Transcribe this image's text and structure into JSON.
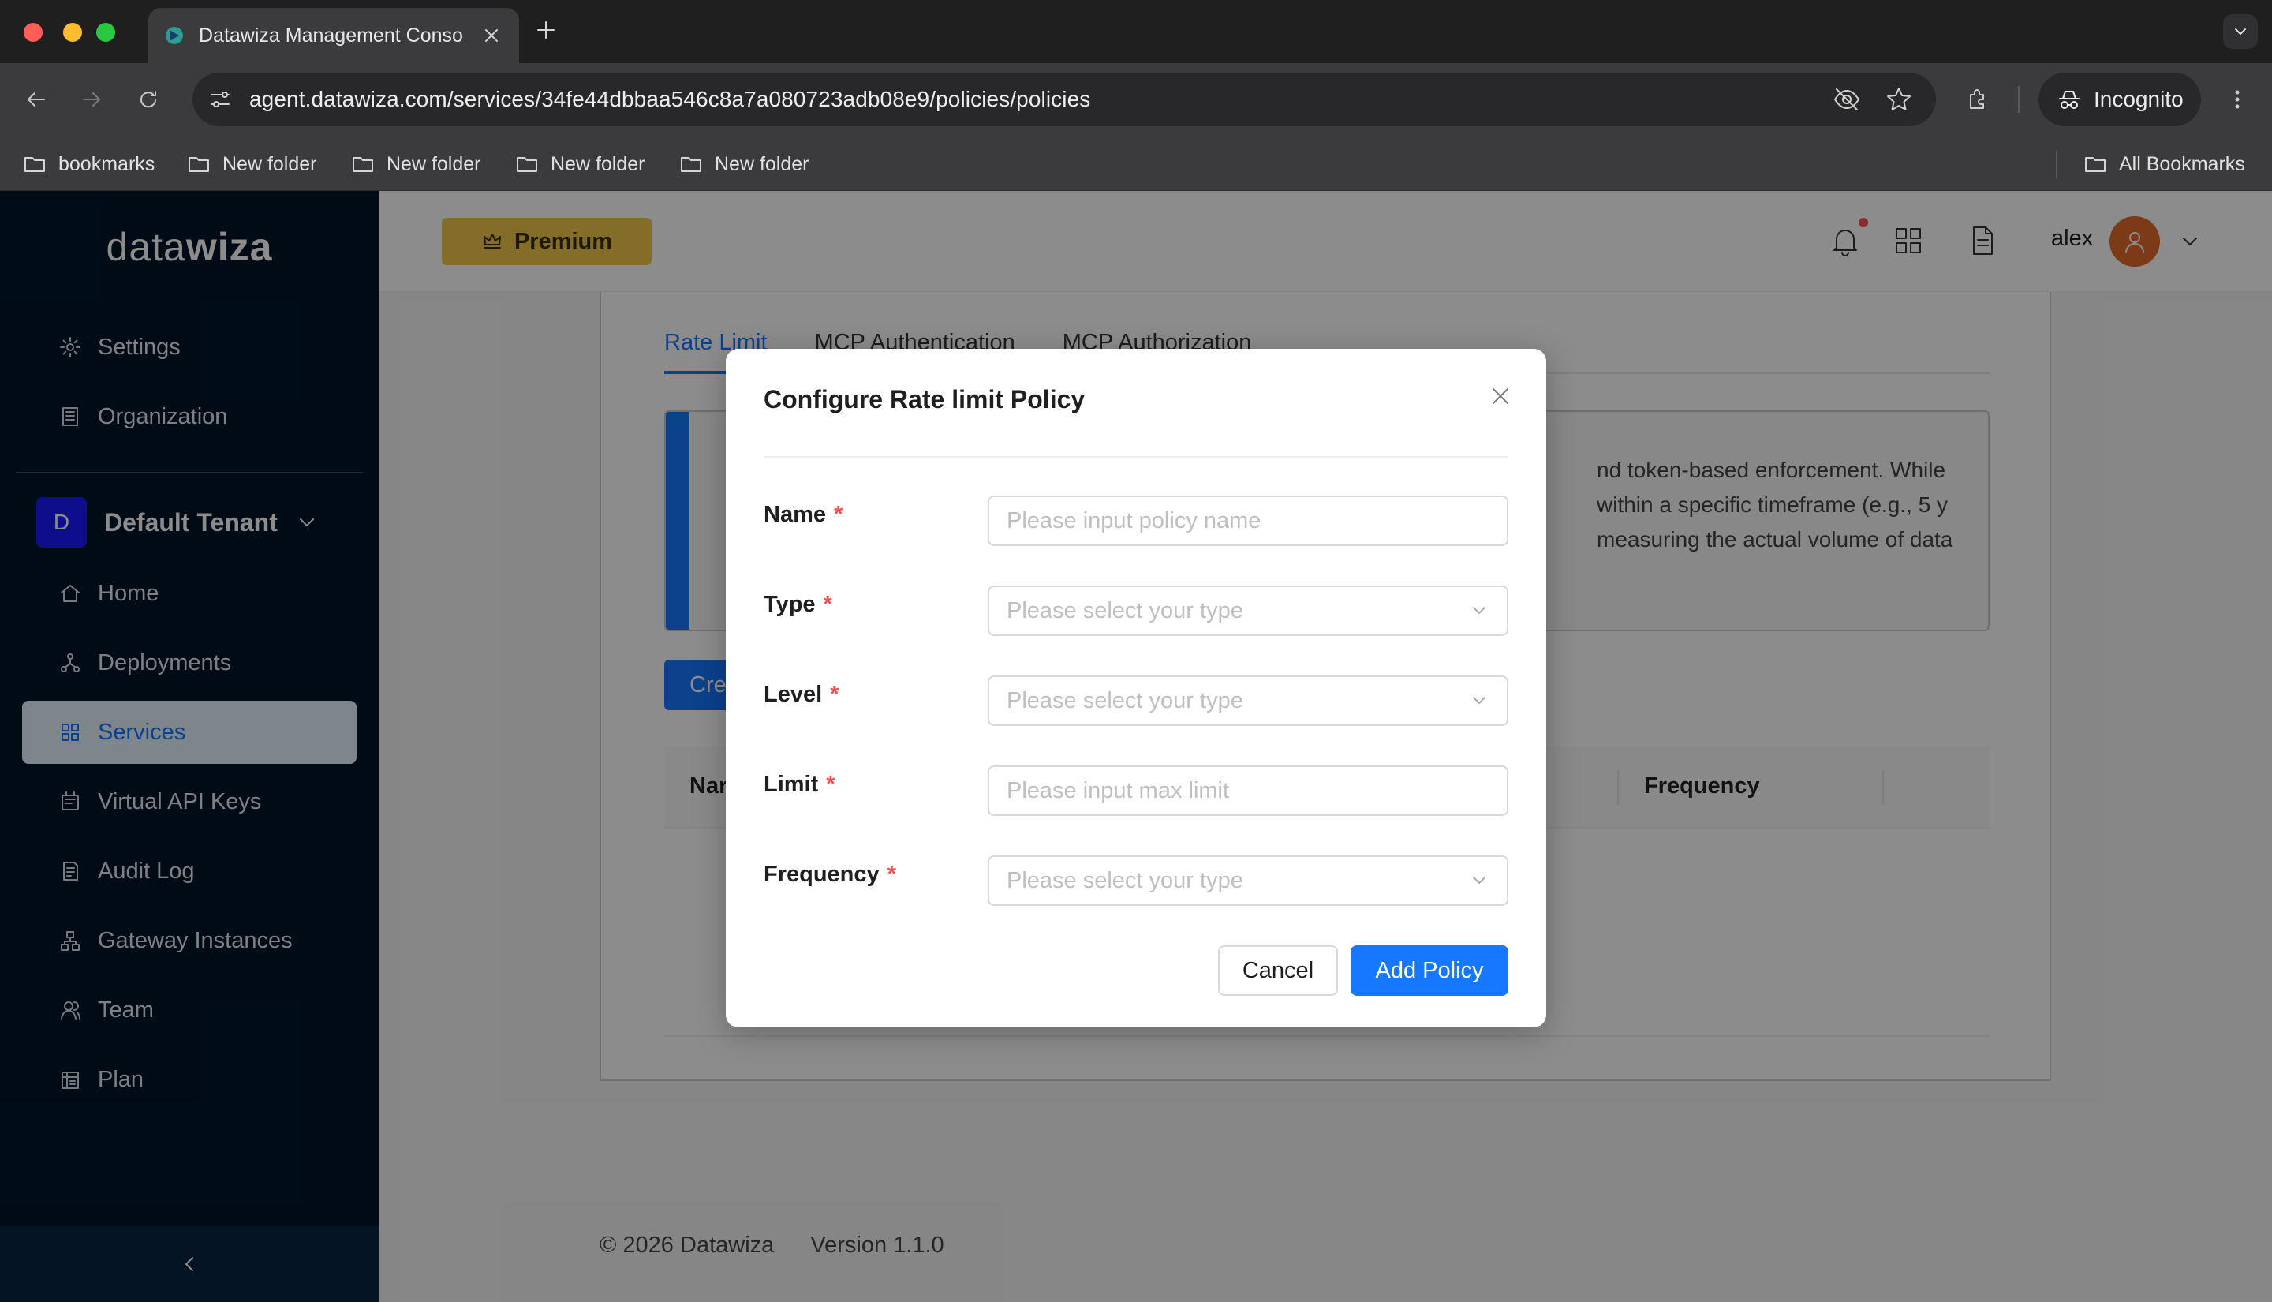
{
  "browser": {
    "tab_title": "Datawiza Management Conso",
    "url": "agent.datawiza.com/services/34fe44dbbaa546c8a7a080723adb08e9/policies/policies",
    "incognito_label": "Incognito",
    "bookmarks": [
      "bookmarks",
      "New folder",
      "New folder",
      "New folder",
      "New folder"
    ],
    "all_bookmarks": "All Bookmarks"
  },
  "sidebar": {
    "logo_prefix": "data",
    "logo_suffix": "wiza",
    "top_items": [
      {
        "label": "Settings",
        "icon": "gear-icon"
      },
      {
        "label": "Organization",
        "icon": "building-icon"
      }
    ],
    "tenant": {
      "initial": "D",
      "name": "Default Tenant"
    },
    "items": [
      {
        "label": "Home",
        "icon": "home-icon"
      },
      {
        "label": "Deployments",
        "icon": "deployments-icon"
      },
      {
        "label": "Services",
        "icon": "grid-icon",
        "active": true
      },
      {
        "label": "Virtual API Keys",
        "icon": "keys-icon"
      },
      {
        "label": "Audit Log",
        "icon": "audit-icon"
      },
      {
        "label": "Gateway Instances",
        "icon": "network-icon"
      },
      {
        "label": "Team",
        "icon": "team-icon"
      },
      {
        "label": "Plan",
        "icon": "plan-icon"
      }
    ]
  },
  "header": {
    "premium_label": "Premium",
    "user_name": "alex"
  },
  "content": {
    "tabs": [
      "Rate Limit",
      "MCP Authentication",
      "MCP Authorization"
    ],
    "alert_text": "nd token-based enforcement. While within a specific timeframe (e.g., 5 y measuring the actual volume of data",
    "create_button": "Cre",
    "table_headers": [
      "Nar",
      "Frequency"
    ]
  },
  "footer": {
    "copyright": "© 2026 Datawiza",
    "version": "Version 1.1.0"
  },
  "modal": {
    "title": "Configure Rate limit Policy",
    "fields": [
      {
        "label": "Name",
        "type": "input",
        "placeholder": "Please input policy name",
        "value": ""
      },
      {
        "label": "Type",
        "type": "select",
        "placeholder": "Please select your type"
      },
      {
        "label": "Level",
        "type": "select",
        "placeholder": "Please select your type"
      },
      {
        "label": "Limit",
        "type": "input",
        "placeholder": "Please input max limit",
        "value": ""
      },
      {
        "label": "Frequency",
        "type": "select",
        "placeholder": "Please select your type"
      }
    ],
    "cancel_label": "Cancel",
    "submit_label": "Add Policy"
  },
  "colors": {
    "primary": "#1677ff",
    "sidebar_bg": "#001529",
    "premium": "#f0c64a",
    "required": "#ff4d4f"
  }
}
